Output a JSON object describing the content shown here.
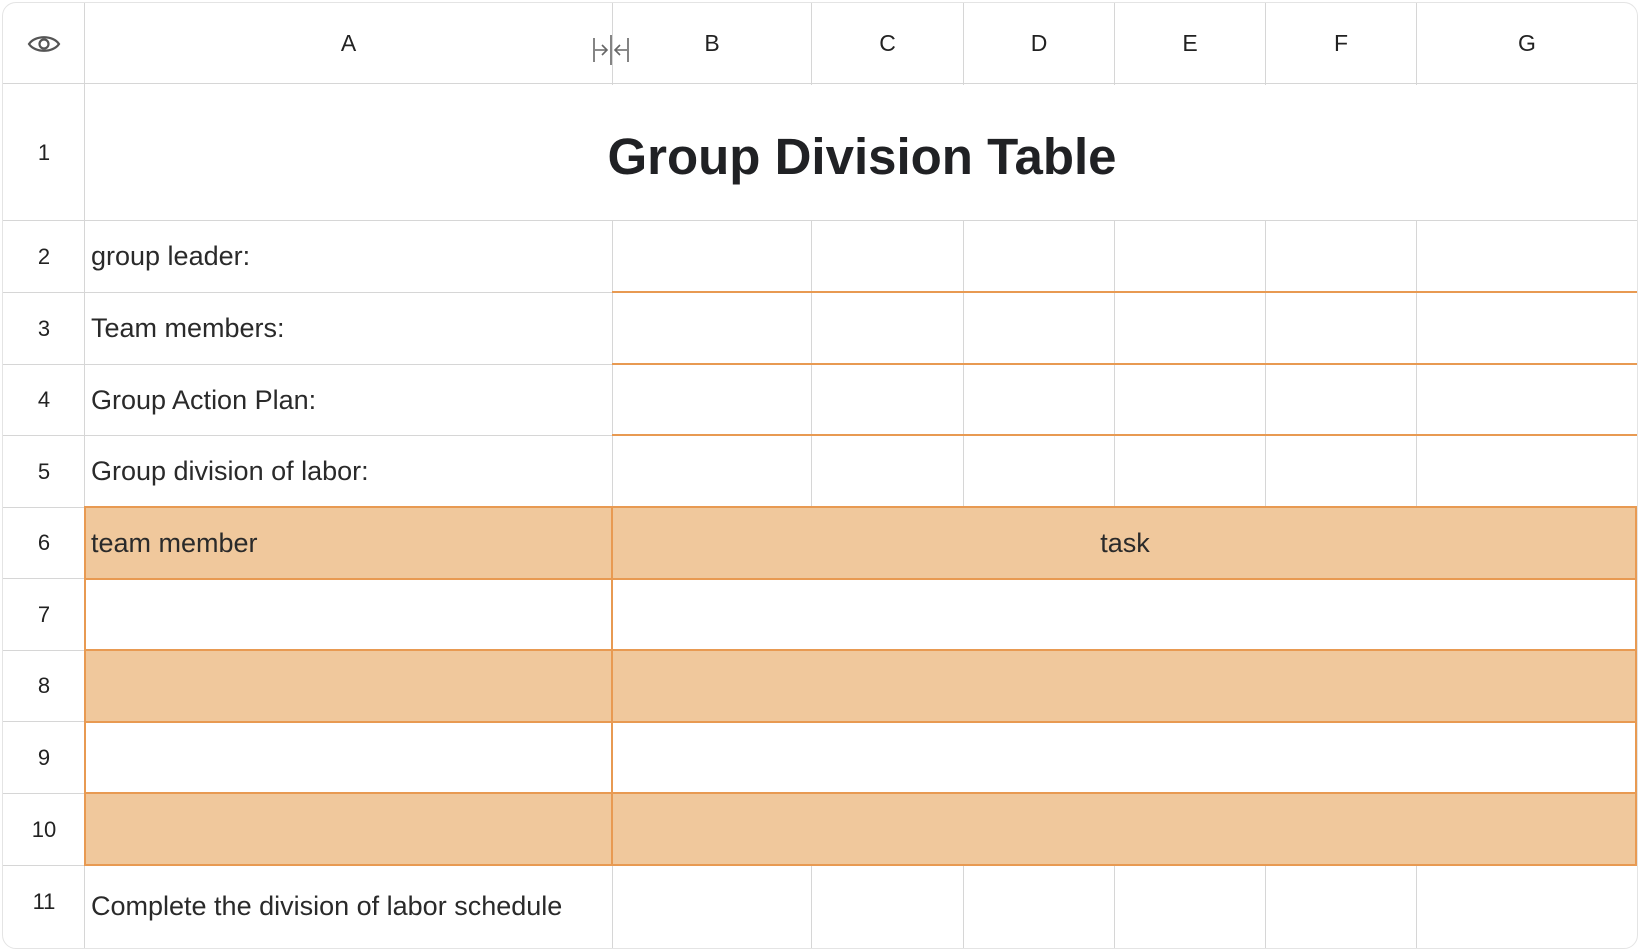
{
  "header": {
    "view_icon": "eye-icon",
    "resize_icon": "column-resize-icon",
    "columns": [
      "A",
      "B",
      "C",
      "D",
      "E",
      "F",
      "G"
    ]
  },
  "rows": [
    "1",
    "2",
    "3",
    "4",
    "5",
    "6",
    "7",
    "8",
    "9",
    "10",
    "11"
  ],
  "cells": {
    "title": "Group Division Table",
    "a2": "group leader:",
    "a3": "Team members:",
    "a4": "Group Action Plan:",
    "a5": "Group division of labor:",
    "a6": "team member",
    "b6": "task",
    "a11": "Complete the division of labor schedule"
  },
  "colors": {
    "accent_fill": "#f0c89c",
    "accent_border": "#e89a52",
    "grid": "#d6d6d6"
  }
}
